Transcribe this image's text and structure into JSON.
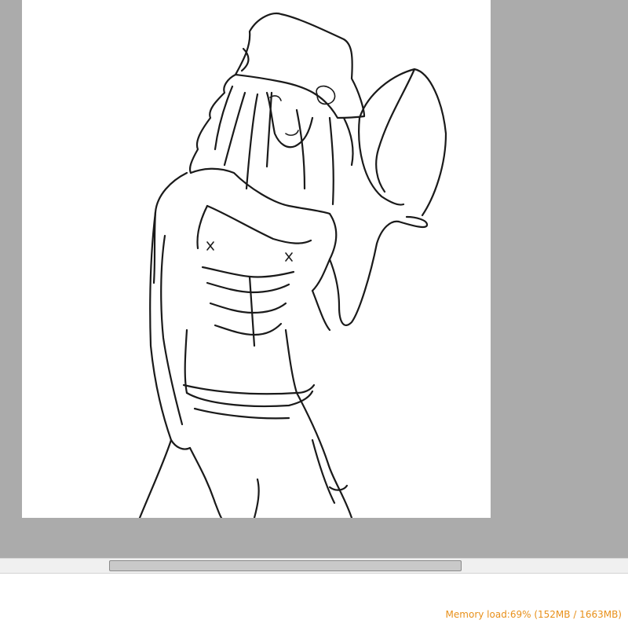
{
  "statusbar": {
    "memory_label": "Memory load:69% (152MB / 1663MB)",
    "memory_color": "#e8901a"
  },
  "canvas": {
    "content": "line-art sketch"
  },
  "colors": {
    "workspace_bg": "#ababab",
    "canvas_bg": "#ffffff",
    "scrollbar_thumb": "#c9c9c9"
  }
}
